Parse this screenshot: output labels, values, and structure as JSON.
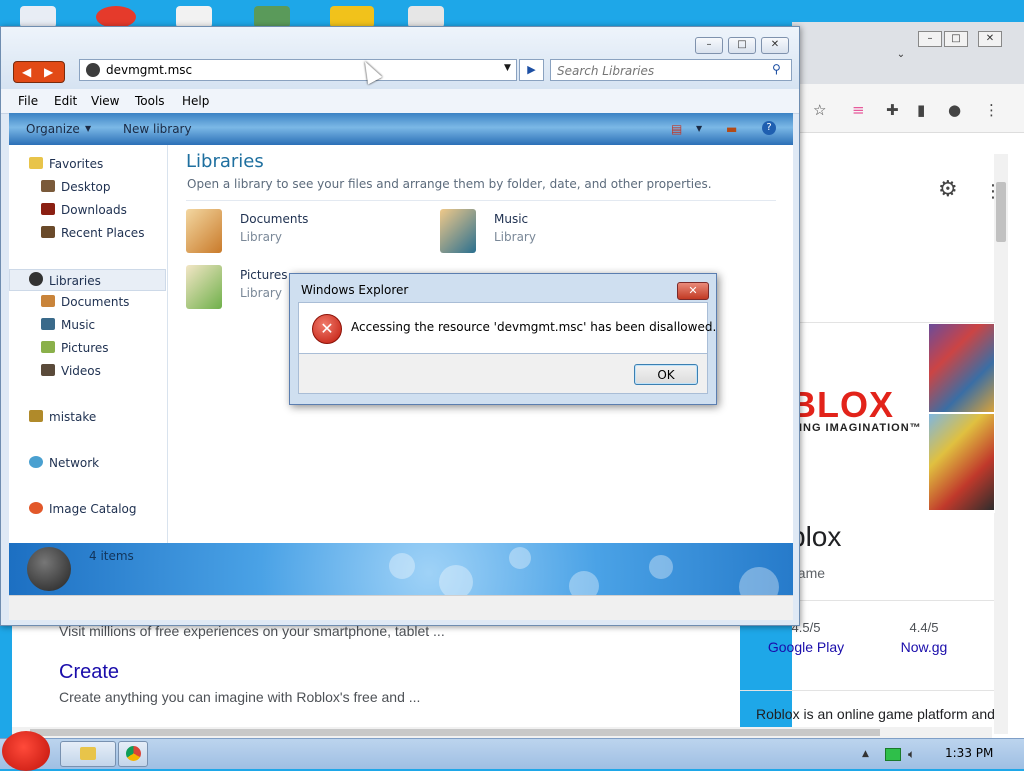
{
  "explorer": {
    "address": "devmgmt.msc",
    "search_placeholder": "Search Libraries",
    "menu": [
      "File",
      "Edit",
      "View",
      "Tools",
      "Help"
    ],
    "commands": {
      "organize": "Organize",
      "new_library": "New library"
    },
    "nav": {
      "favorites": "Favorites",
      "favorites_items": [
        "Desktop",
        "Downloads",
        "Recent Places"
      ],
      "libraries": "Libraries",
      "libraries_items": [
        "Documents",
        "Music",
        "Pictures",
        "Videos"
      ],
      "mistake": "mistake",
      "network": "Network",
      "image_catalog": "Image Catalog"
    },
    "content": {
      "title": "Libraries",
      "description": "Open a library to see your files and arrange them by folder, date, and other properties.",
      "libraries": [
        {
          "name": "Documents",
          "type": "Library"
        },
        {
          "name": "Music",
          "type": "Library"
        },
        {
          "name": "Pictures",
          "type": "Library"
        }
      ]
    },
    "details": {
      "items": "4 items"
    }
  },
  "dialog": {
    "title": "Windows Explorer",
    "message": "Accessing the resource 'devmgmt.msc' has been disallowed.",
    "ok": "OK"
  },
  "browser": {
    "roblox_logo": "BLOX",
    "roblox_tagline": "RING IMAGINATION™",
    "title_fragment": "blox",
    "subtitle_fragment": "game",
    "ratings": [
      {
        "score": "4.5/5",
        "source": "Google Play"
      },
      {
        "score": "4.4/5",
        "source": "Now.gg"
      }
    ],
    "description": "Roblox is an online game platform and",
    "result_snippet": "Visit millions of free experiences on your smartphone, tablet ...",
    "create_title": "Create",
    "create_snippet": "Create anything you can imagine with Roblox's free and ..."
  },
  "taskbar": {
    "clock": "1:33 PM"
  },
  "colors": {
    "desktop": "#1ea7e8",
    "roblox_red": "#e2231a",
    "link_blue": "#1a0dab"
  }
}
